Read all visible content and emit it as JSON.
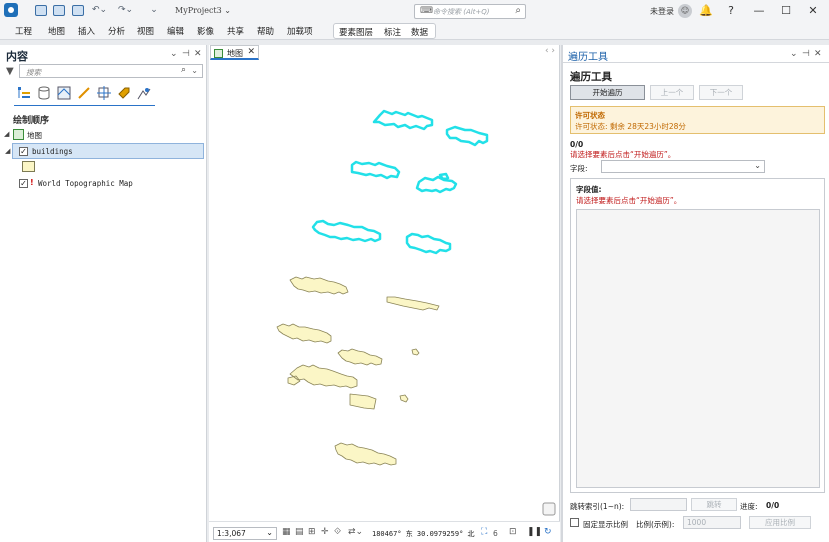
{
  "titlebar": {
    "project_name": "MyProject3 ⌄",
    "command_search_placeholder": "命令搜索 (Alt+Q)",
    "user_status": "未登录",
    "help": "?",
    "minimize": "—",
    "maximize": "☐",
    "close": "✕"
  },
  "menu": [
    "工程",
    "地图",
    "插入",
    "分析",
    "视图",
    "编辑",
    "影像",
    "共享",
    "帮助",
    "加载项"
  ],
  "context_tabs": [
    "要素图层",
    "标注",
    "数据"
  ],
  "contents": {
    "title": "内容",
    "search_placeholder": "搜索",
    "drawing_order": "绘制顺序",
    "map_name": "地图",
    "layer_name": "buildings",
    "basemap_name": "World Topographic Map",
    "pin": "⊣",
    "close": "✕",
    "menu": "⌄"
  },
  "map": {
    "tab_label": "地图",
    "scale": "1:3,067",
    "coordinates": "180467° 东 30.0979259° 北",
    "selected_count": "6",
    "nav_arrows": "‹ ›"
  },
  "tool": {
    "pane_title": "遍历工具",
    "title": "遍历工具",
    "start_button": "开始遍历",
    "prev_button": "上一个",
    "next_button": "下一个",
    "license_heading": "许可状态",
    "license_text": "许可状态: 剩余 28天23小时28分",
    "count": "0/0",
    "hint": "请选择要素后点击“开始遍历”。",
    "field_label": "字段:",
    "field_values_label": "字段值:",
    "field_values_hint": "请选择要素后点击“开始遍历”。",
    "jump_label": "跳转索引(1~n):",
    "jump_button": "跳转",
    "progress_label": "进度:",
    "progress_value": "0/0",
    "fixed_scale_label": "固定显示比例",
    "ratio_label": "比例(示例):",
    "ratio_value": "1000",
    "apply_button": "应用比例"
  },
  "colors": {
    "selected_outline": "#22e0e8",
    "feature_fill": "#fbf6c6",
    "feature_stroke": "#8a8457",
    "accent": "#2a73c8",
    "warning": "#c06800",
    "error_text": "#c01818"
  }
}
